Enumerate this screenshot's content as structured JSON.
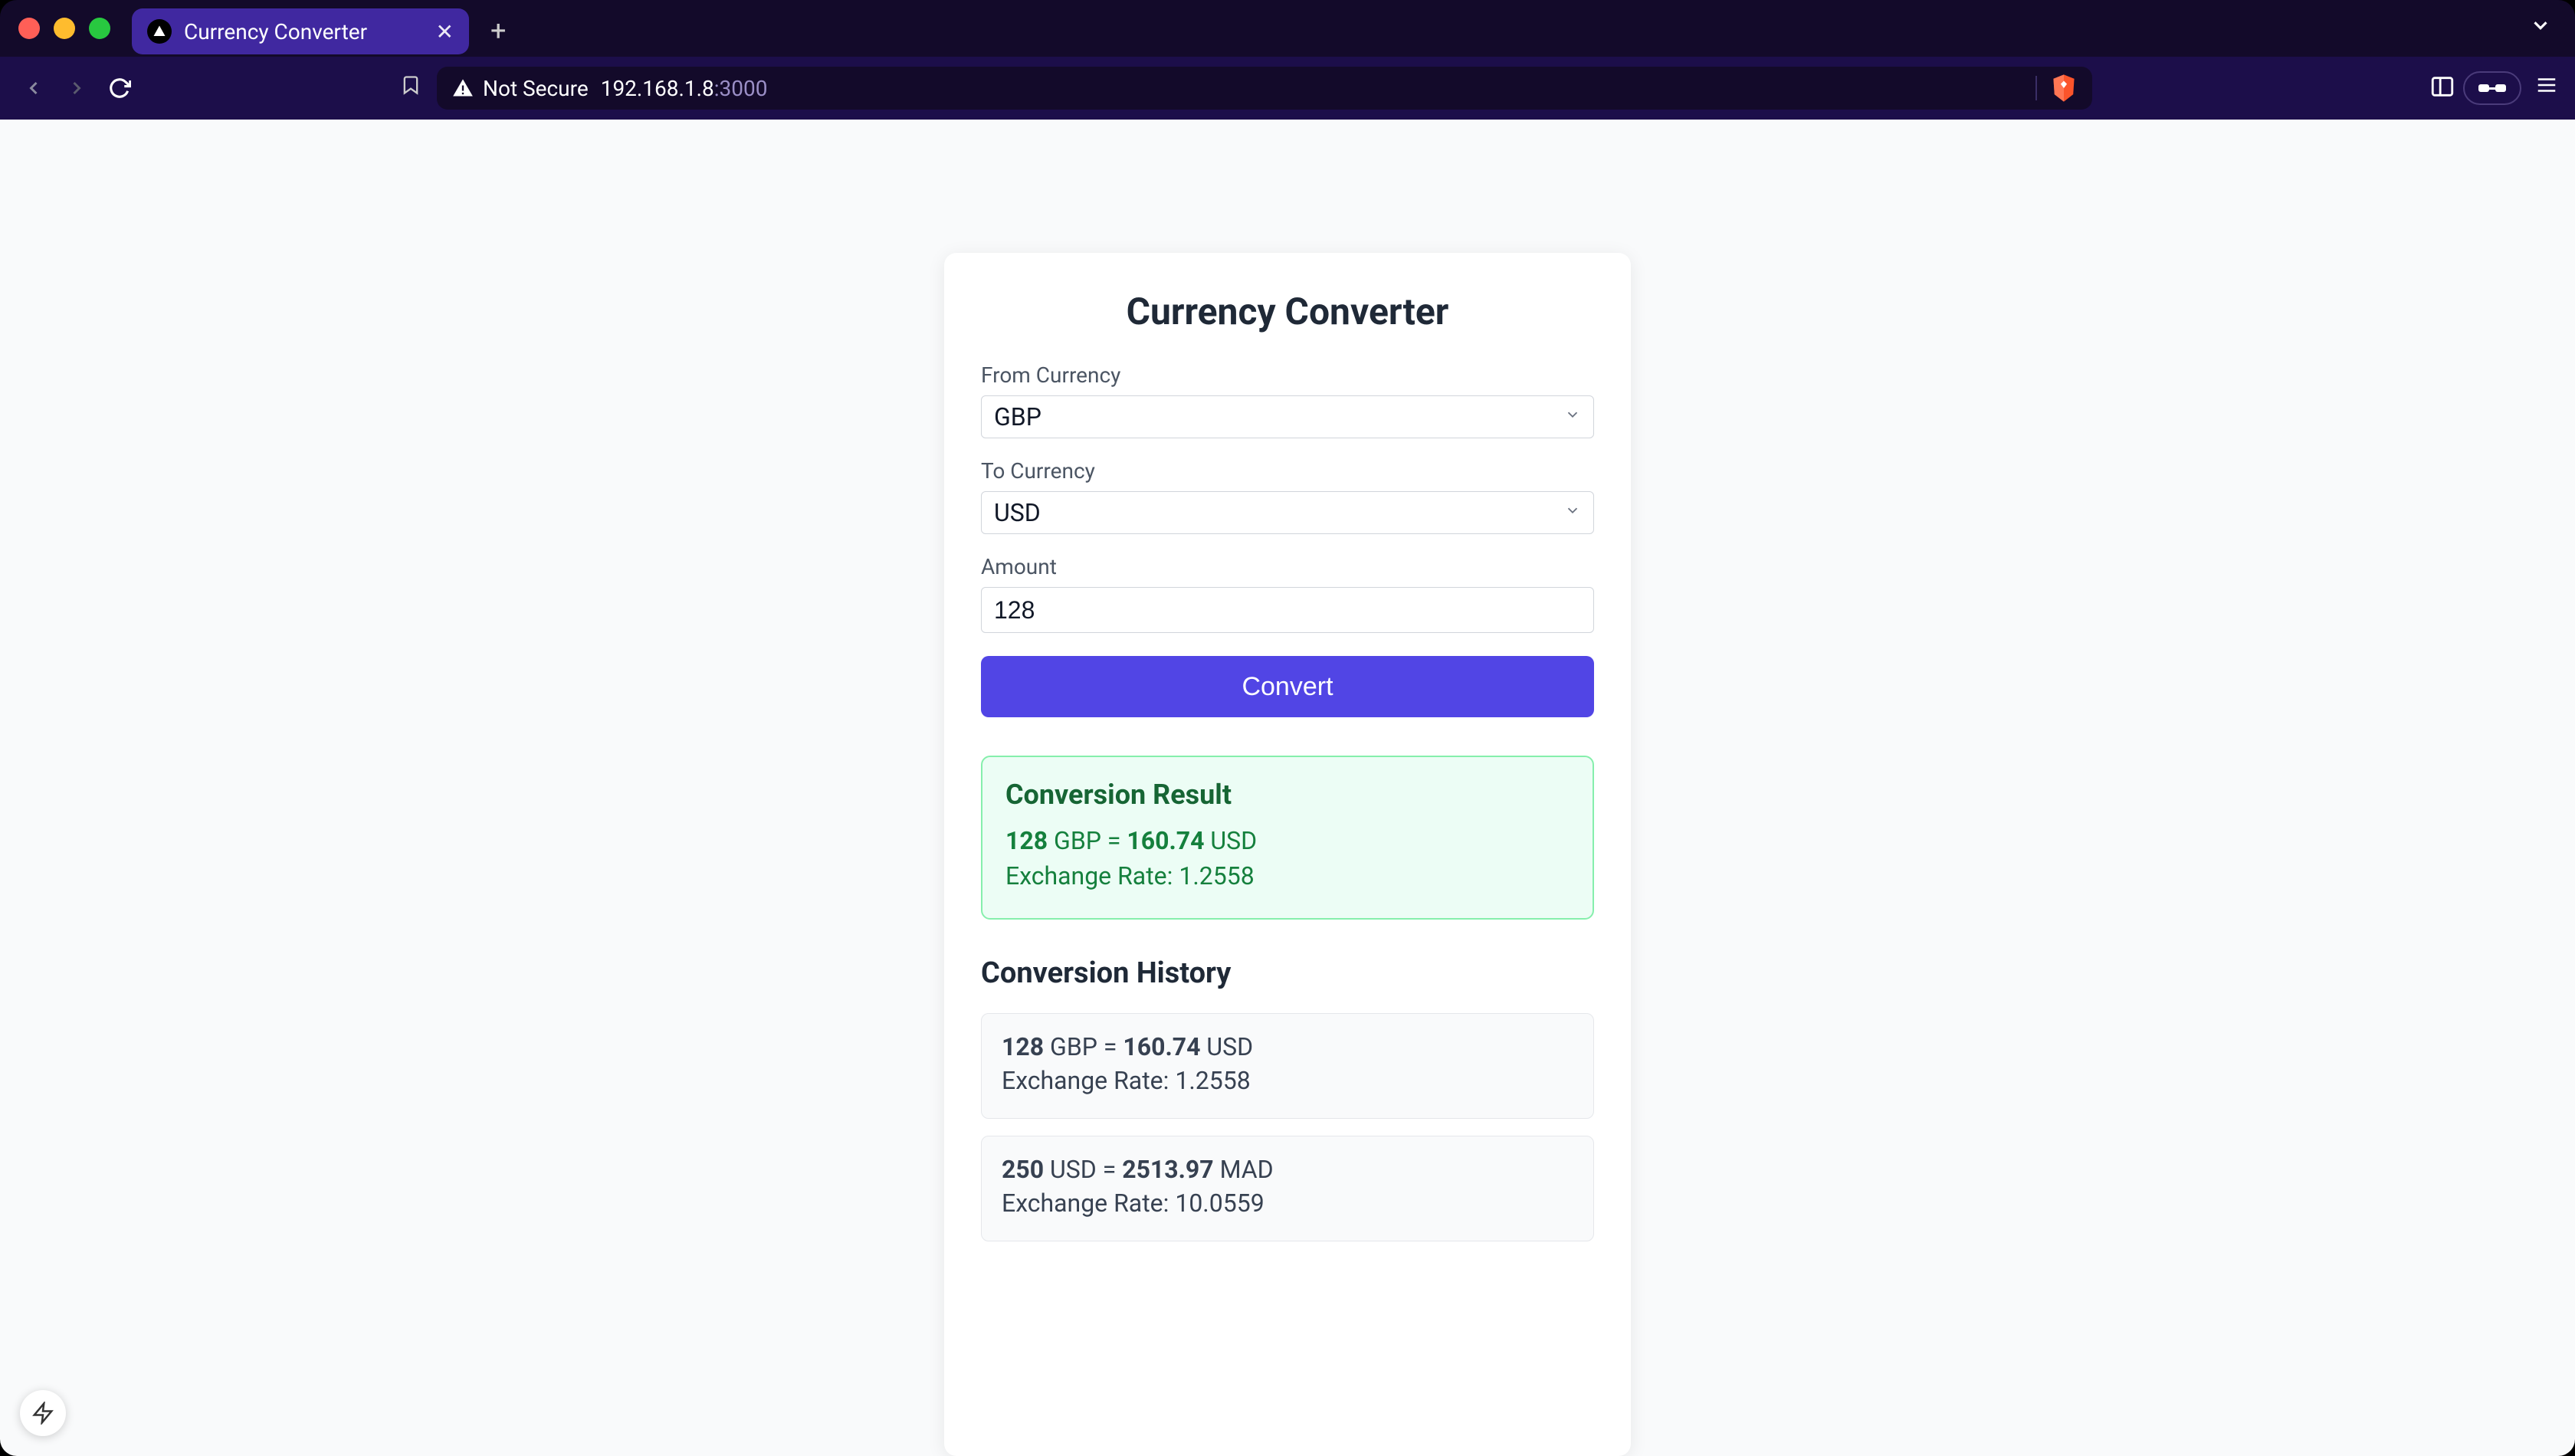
{
  "browser": {
    "tab_title": "Currency Converter",
    "not_secure_label": "Not Secure",
    "url_host": "192.168.1.8",
    "url_port": ":3000"
  },
  "app": {
    "title": "Currency Converter",
    "from_label": "From Currency",
    "from_value": "GBP",
    "to_label": "To Currency",
    "to_value": "USD",
    "amount_label": "Amount",
    "amount_value": "128",
    "convert_button": "Convert"
  },
  "result": {
    "title": "Conversion Result",
    "amount": "128",
    "from_code": "GBP",
    "equals": " = ",
    "converted": "160.74",
    "to_code": "USD",
    "rate_label": "Exchange Rate: ",
    "rate_value": "1.2558"
  },
  "history": {
    "title": "Conversion History",
    "items": [
      {
        "amount": "128",
        "from_code": "GBP",
        "converted": "160.74",
        "to_code": "USD",
        "rate_label": "Exchange Rate: ",
        "rate_value": "1.2558"
      },
      {
        "amount": "250",
        "from_code": "USD",
        "converted": "2513.97",
        "to_code": "MAD",
        "rate_label": "Exchange Rate: ",
        "rate_value": "10.0559"
      }
    ]
  }
}
